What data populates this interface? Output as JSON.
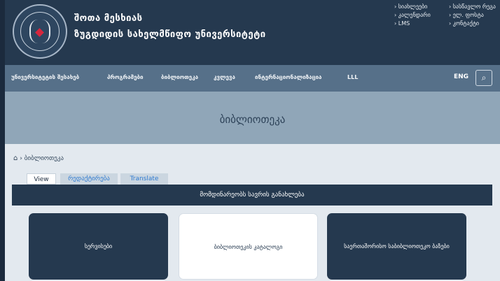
{
  "header": {
    "title_line1": "შოთა მესხიას",
    "title_line2": "ზუგდიდის სახელმწიფო უნივერსიტეტი",
    "top_links_col1": [
      "› სიახლეები",
      "› კალენდარი",
      "› LMS"
    ],
    "top_links_col2": [
      "› სასწავლო რეგა",
      "› ელ. ფოსტა",
      "› კონტაქტი"
    ]
  },
  "nav": {
    "items": [
      "უნივერსიტეტის შესახებ",
      "პროგრამები",
      "ბიბლიოთეკა",
      "კვლევა",
      "ინტერნაციონალიზაცია",
      "LLL"
    ],
    "lang": "ENG",
    "search_icon": "⌕"
  },
  "banner": {
    "title": "ბიბლიოთეკა"
  },
  "breadcrumb": {
    "home_icon": "⌂",
    "separator": "›",
    "current": "ბიბლიოთეკა"
  },
  "tabs": {
    "view": "View",
    "edit": "რედაქტირება",
    "translate": "Translate"
  },
  "section_bar": "მომდინარეობს სავრის განახლება",
  "cards": [
    {
      "label": "სერვისები",
      "style": "dark"
    },
    {
      "label": "ბიბლიოთეკის კატალოგი",
      "style": "light"
    },
    {
      "label": "საერთაშორისო საბიბლიოთეკო ბაზები",
      "style": "dark"
    }
  ],
  "colors": {
    "header_bg": "#25394f",
    "nav_bg": "#567089",
    "banner_bg": "#90a6b8",
    "page_bg": "#e3e9ef",
    "link_blue": "#2f7bd1"
  }
}
